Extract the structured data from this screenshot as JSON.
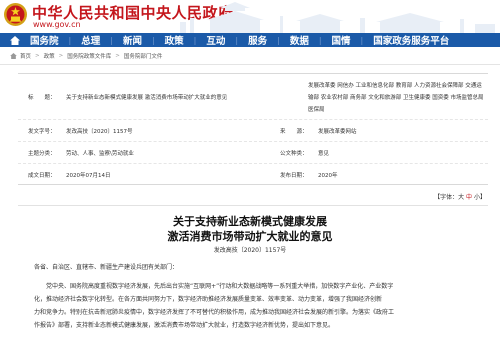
{
  "header": {
    "site_title": "中华人民共和国中央人民政府",
    "site_url": "www.gov.cn",
    "emblem_icon": "national-emblem-icon",
    "skyline_icon": "tiananmen-skyline-icon"
  },
  "nav": {
    "home_icon": "home-icon",
    "items": [
      "国务院",
      "总理",
      "新闻",
      "政策",
      "互动",
      "服务",
      "数据",
      "国情",
      "国家政务服务平台"
    ]
  },
  "breadcrumb": {
    "home_icon": "home-icon",
    "items": [
      "首页",
      "政策",
      "国务院政策文件库",
      "国务院部门文件"
    ]
  },
  "meta": {
    "title_label": "标　　题：",
    "title_value": "关于支持新业态新模式健康发展 激活消费市场带动扩大就业的意见",
    "topic_text": "发展改革委 网信办 工业和信息化部 教育部 人力资源社会保障部 交通运输部 农业农村部 商务部 文化和旅游部 卫生健康委 国资委 市场监管总局 医保局",
    "doc_no_label": "发文字号：",
    "doc_no_value": "发改高技〔2020〕1157号",
    "source_label": "来　　源：",
    "source_value": "发展改革委网站",
    "category_label": "主题分类：",
    "category_value": "劳动、人事、监察\\劳动就业",
    "type_label": "公文种类：",
    "type_value": "意见",
    "date_label": "成文日期：",
    "date_value": "2020年07月14日",
    "publish_label": "发布日期：",
    "publish_value": "2020年"
  },
  "font_size": {
    "label": "【字体：",
    "large": "大",
    "medium": "中",
    "small": "小",
    "close": "】"
  },
  "document": {
    "title_line1": "关于支持新业态新模式健康发展",
    "title_line2": "激活消费市场带动扩大就业的意见",
    "number": "发改高技〔2020〕1157号",
    "salutation": "各省、自治区、直辖市、新疆生产建设兵团有关部门：",
    "p1_line1": "　　党中央、国务院高度重视数字经济发展，先后出台实施“互联网+”行动和大数据战略等一系列重大举措，加快数字产业化、产业数字",
    "p1_line2": "化，推动经济社会数字化转型。在各方面共同努力下，数字经济助推经济发展质量变革、效率变革、动力变革，增强了我国经济创新",
    "p1_line3": "力和竞争力。特别在抗击新冠肺炎疫情中，数字经济发挥了不可替代的积极作用，成为推动我国经济社会发展的新引擎。为落实《政府工",
    "p1_line4": "作报告》部署，支持新业态新模式健康发展，激活消费市场带动扩大就业，打造数字经济新优势，提出如下意见。"
  },
  "colors": {
    "brand_red": "#c4161c",
    "nav_blue": "#1b5aa8"
  }
}
